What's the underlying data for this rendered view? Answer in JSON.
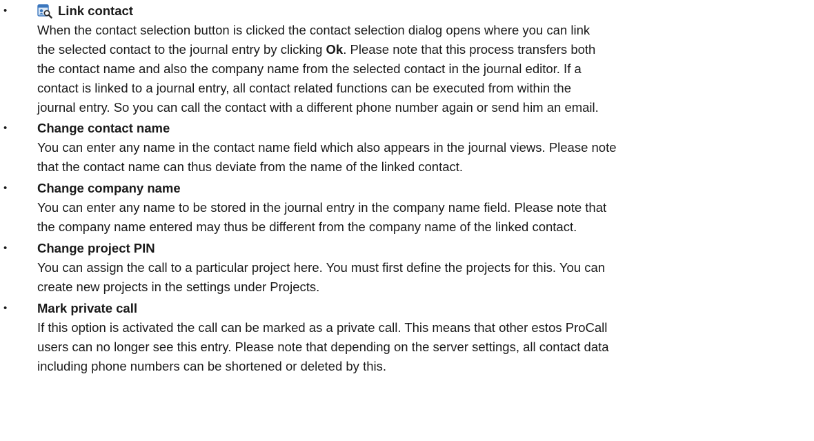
{
  "items": [
    {
      "title": "Link contact",
      "icon": "contact-search-icon",
      "lines": [
        [
          "When the contact selection button is clicked the contact selection dialog opens where you can link"
        ],
        [
          "the selected contact to the journal entry by clicking ",
          {
            "b": "Ok"
          },
          ". Please note that this process transfers both"
        ],
        [
          "the contact name and also the company name from the selected contact in the journal editor. If a"
        ],
        [
          "contact is linked to a journal entry, all contact related functions can be executed from within the"
        ],
        [
          "journal entry. So you can call the contact with a different phone number again or send him an email."
        ]
      ]
    },
    {
      "title": "Change contact name",
      "lines": [
        [
          "You can enter any name in the contact name field which also appears in the journal views. Please note"
        ],
        [
          "that the contact name can thus deviate from the name of the linked contact."
        ]
      ]
    },
    {
      "title": "Change company name",
      "lines": [
        [
          "You can enter any name to be stored in the journal entry in the company name field. Please note that"
        ],
        [
          "the company name entered may thus be different from the company name of the linked contact."
        ]
      ]
    },
    {
      "title": "Change project PIN",
      "lines": [
        [
          "You can assign the call to a particular project here. You must first define the projects for this. You can"
        ],
        [
          "create new projects in the settings under Projects."
        ]
      ]
    },
    {
      "title": "Mark private call",
      "lines": [
        [
          "If this option is activated the call can be marked as a private call. This means that other estos ProCall"
        ],
        [
          "users can no longer see this entry. Please note that depending on the server settings, all contact data"
        ],
        [
          "including phone numbers can be shortened or deleted by this."
        ]
      ]
    }
  ]
}
